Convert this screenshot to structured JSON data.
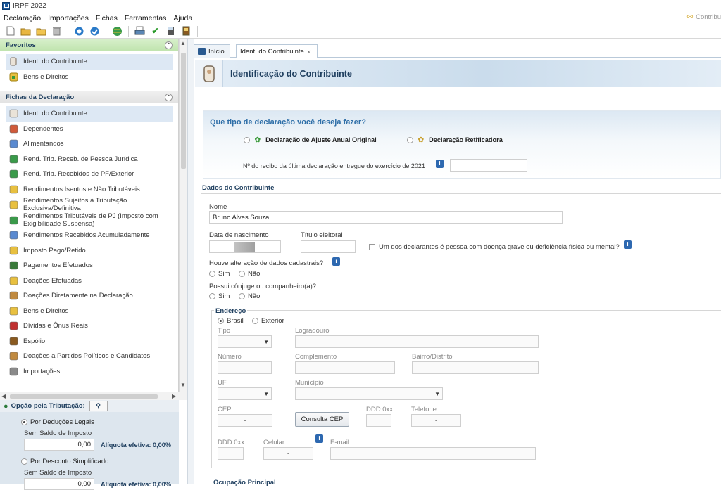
{
  "window": {
    "title": "IRPF 2022",
    "contrib_label": "Contribu"
  },
  "menu": [
    "Declaração",
    "Importações",
    "Fichas",
    "Ferramentas",
    "Ajuda"
  ],
  "toolbar_icons": [
    "new-doc-icon",
    "open-folder-icon",
    "folder-icon",
    "trash-icon",
    "transmit-icon",
    "receive-icon",
    "globe-icon",
    "print-icon",
    "check-icon",
    "calculator-icon",
    "book-icon"
  ],
  "sidebar": {
    "favoritos_title": "Favoritos",
    "favoritos": [
      {
        "label": "Ident. do Contribuinte",
        "icon": "person-icon"
      },
      {
        "label": "Bens e Direitos",
        "icon": "house-icon"
      }
    ],
    "fichas_title": "Fichas da Declaração",
    "fichas": [
      {
        "label": "Ident. do Contribuinte",
        "icon": "person-icon"
      },
      {
        "label": "Dependentes",
        "icon": "dependents-icon"
      },
      {
        "label": "Alimentandos",
        "icon": "alimentandos-icon"
      },
      {
        "label": "Rend. Trib. Receb. de Pessoa Jurídica",
        "icon": "money-icon"
      },
      {
        "label": "Rend. Trib. Recebidos de PF/Exterior",
        "icon": "money-person-icon"
      },
      {
        "label": "Rendimentos Isentos e Não Tributáveis",
        "icon": "exempt-icon"
      },
      {
        "label": "Rendimentos Sujeitos à Tributação Exclusiva/Definitiva",
        "icon": "exclusive-icon"
      },
      {
        "label": "Rendimentos Tributáveis de PJ (Imposto com Exigibilidade Suspensa)",
        "icon": "suspended-icon"
      },
      {
        "label": "Rendimentos Recebidos Acumuladamente",
        "icon": "accumulated-icon"
      },
      {
        "label": "Imposto Pago/Retido",
        "icon": "tax-paid-icon"
      },
      {
        "label": "Pagamentos Efetuados",
        "icon": "card-icon"
      },
      {
        "label": "Doações Efetuadas",
        "icon": "donation-icon"
      },
      {
        "label": "Doações Diretamente na Declaração",
        "icon": "donation-direct-icon"
      },
      {
        "label": "Bens e Direitos",
        "icon": "house-icon"
      },
      {
        "label": "Dívidas e Ônus Reais",
        "icon": "debt-icon"
      },
      {
        "label": "Espólio",
        "icon": "chest-icon"
      },
      {
        "label": "Doações a Partidos Políticos e Candidatos",
        "icon": "politics-icon"
      },
      {
        "label": "Importações",
        "icon": "import-icon"
      }
    ]
  },
  "tributacao": {
    "title": "Opção pela Tributação:",
    "opt1": "Por Deduções Legais",
    "opt1_sub": "Sem Saldo de Imposto",
    "opt1_value": "0,00",
    "opt1_aliquota": "Alíquota efetiva: 0,00%",
    "opt2": "Por Desconto Simplificado",
    "opt2_sub": "Sem Saldo de Imposto",
    "opt2_value": "0,00",
    "opt2_aliquota": "Alíquota efetiva: 0,00%"
  },
  "tabs": [
    {
      "label": "Início"
    },
    {
      "label": "Ident. do Contribuinte"
    }
  ],
  "header_title": "Identificação do Contribuinte",
  "declaracao": {
    "question": "Que tipo de declaração você deseja fazer?",
    "opt_original": "Declaração de Ajuste Anual Original",
    "opt_retificadora": "Declaração Retificadora",
    "recibo_label": "Nº do recibo da última declaração entregue do exercício de 2021"
  },
  "dados": {
    "title": "Dados do Contribuinte",
    "nome_label": "Nome",
    "nome_value": "Bruno Alves Souza",
    "nasc_label": "Data de nascimento",
    "titulo_label": "Título eleitoral",
    "doenca_label": "Um dos declarantes é pessoa com doença grave ou deficiência física ou mental?",
    "alteracao_label": "Houve alteração de dados cadastrais?",
    "conjuge_label": "Possui cônjuge ou companheiro(a)?",
    "sim": "Sim",
    "nao": "Não"
  },
  "endereco": {
    "title": "Endereço",
    "brasil": "Brasil",
    "exterior": "Exterior",
    "tipo": "Tipo",
    "logradouro": "Logradouro",
    "numero": "Número",
    "complemento": "Complemento",
    "bairro": "Bairro/Distrito",
    "uf": "UF",
    "municipio": "Município",
    "cep": "CEP",
    "cep_value": "-",
    "consulta_cep": "Consulta CEP",
    "ddd1": "DDD 0xx",
    "telefone": "Telefone",
    "telefone_value": "-",
    "ddd2": "DDD 0xx",
    "celular": "Celular",
    "celular_value": "-",
    "email": "E-mail"
  },
  "ocupacao_title": "Ocupação Principal"
}
